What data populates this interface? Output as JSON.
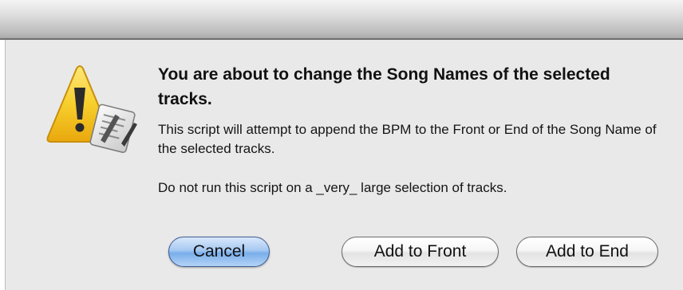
{
  "dialog": {
    "heading": "You are about to change the Song Names of the selected tracks.",
    "message_1": "This script will attempt to append the BPM to the Front or End of the Song Name of the selected tracks.",
    "message_2": "Do not run this script on a _very_ large selection of tracks.",
    "icon": "caution-script-icon"
  },
  "buttons": {
    "cancel": "Cancel",
    "add_front": "Add to Front",
    "add_end": "Add to End"
  },
  "colors": {
    "default_button": "#79aeea",
    "warning_triangle": "#f5c61a",
    "dialog_background": "#e9e9e9"
  }
}
